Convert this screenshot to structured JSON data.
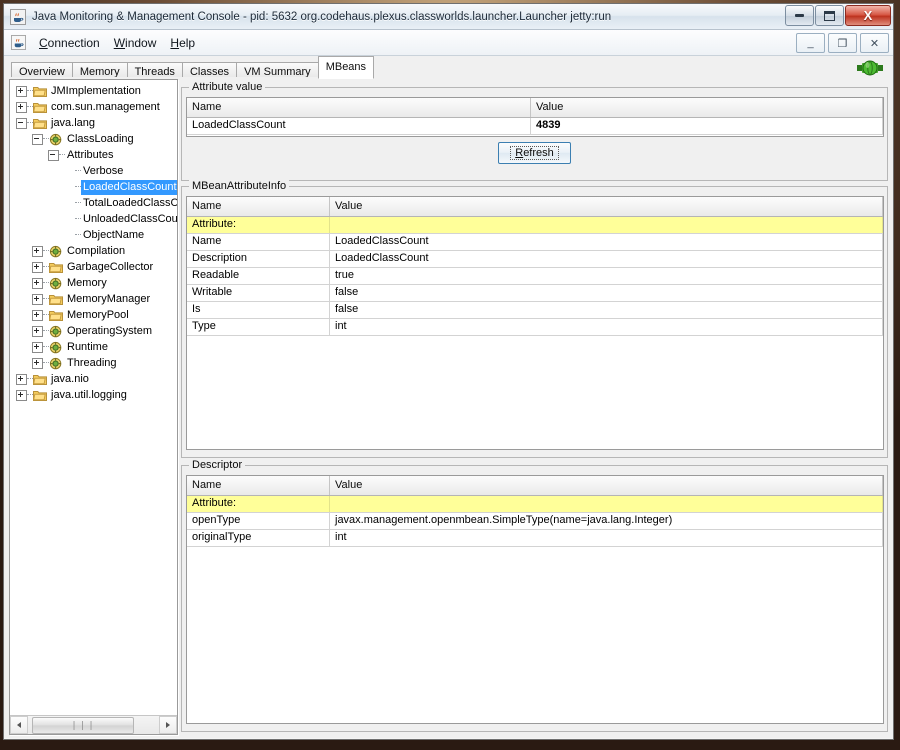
{
  "window": {
    "title": "Java Monitoring & Management Console - pid: 5632 org.codehaus.plexus.classworlds.launcher.Launcher jetty:run",
    "app_icon": "java-cup-icon",
    "buttons": {
      "minimize": "minimize-icon",
      "restore": "restore-icon",
      "close": "X"
    }
  },
  "menubar": {
    "icon": "java-cup-icon",
    "items": [
      {
        "label": "Connection",
        "mnemonic": "C"
      },
      {
        "label": "Window",
        "mnemonic": "W"
      },
      {
        "label": "Help",
        "mnemonic": "H"
      }
    ],
    "internal_buttons": {
      "minimize": "_",
      "maximize": "❐",
      "close": "✕"
    }
  },
  "tabs": {
    "items": [
      {
        "label": "Overview",
        "active": false
      },
      {
        "label": "Memory",
        "active": false
      },
      {
        "label": "Threads",
        "active": false
      },
      {
        "label": "Classes",
        "active": false
      },
      {
        "label": "VM Summary",
        "active": false
      },
      {
        "label": "MBeans",
        "active": true
      }
    ],
    "status_icon": "connection-plug-icon"
  },
  "tree": {
    "nodes": [
      {
        "label": "JMImplementation",
        "depth": 0,
        "toggle": "plus",
        "icon": "folder-icon",
        "selected": false
      },
      {
        "label": "com.sun.management",
        "depth": 0,
        "toggle": "plus",
        "icon": "folder-icon",
        "selected": false
      },
      {
        "label": "java.lang",
        "depth": 0,
        "toggle": "minus",
        "icon": "folder-icon",
        "selected": false
      },
      {
        "label": "ClassLoading",
        "depth": 1,
        "toggle": "minus",
        "icon": "mbean-icon",
        "selected": false
      },
      {
        "label": "Attributes",
        "depth": 2,
        "toggle": "minus",
        "icon": "none",
        "selected": false
      },
      {
        "label": "Verbose",
        "depth": 3,
        "toggle": "none",
        "icon": "none",
        "selected": false
      },
      {
        "label": "LoadedClassCount",
        "depth": 3,
        "toggle": "none",
        "icon": "none",
        "selected": true
      },
      {
        "label": "TotalLoadedClassCount",
        "depth": 3,
        "toggle": "none",
        "icon": "none",
        "selected": false
      },
      {
        "label": "UnloadedClassCount",
        "depth": 3,
        "toggle": "none",
        "icon": "none",
        "selected": false
      },
      {
        "label": "ObjectName",
        "depth": 3,
        "toggle": "none",
        "icon": "none",
        "selected": false
      },
      {
        "label": "Compilation",
        "depth": 1,
        "toggle": "plus",
        "icon": "mbean-icon",
        "selected": false
      },
      {
        "label": "GarbageCollector",
        "depth": 1,
        "toggle": "plus",
        "icon": "folder-icon",
        "selected": false
      },
      {
        "label": "Memory",
        "depth": 1,
        "toggle": "plus",
        "icon": "mbean-icon",
        "selected": false
      },
      {
        "label": "MemoryManager",
        "depth": 1,
        "toggle": "plus",
        "icon": "folder-icon",
        "selected": false
      },
      {
        "label": "MemoryPool",
        "depth": 1,
        "toggle": "plus",
        "icon": "folder-icon",
        "selected": false
      },
      {
        "label": "OperatingSystem",
        "depth": 1,
        "toggle": "plus",
        "icon": "mbean-icon",
        "selected": false
      },
      {
        "label": "Runtime",
        "depth": 1,
        "toggle": "plus",
        "icon": "mbean-icon",
        "selected": false
      },
      {
        "label": "Threading",
        "depth": 1,
        "toggle": "plus",
        "icon": "mbean-icon",
        "selected": false
      },
      {
        "label": "java.nio",
        "depth": 0,
        "toggle": "plus",
        "icon": "folder-icon",
        "selected": false
      },
      {
        "label": "java.util.logging",
        "depth": 0,
        "toggle": "plus",
        "icon": "folder-icon",
        "selected": false
      }
    ]
  },
  "attribute_value": {
    "group_title": "Attribute value",
    "columns": [
      "Name",
      "Value"
    ],
    "rows": [
      {
        "name": "LoadedClassCount",
        "value": "4839",
        "bold_value": true
      }
    ],
    "refresh_label": "Refresh",
    "refresh_mnemonic": "R"
  },
  "mbean_attribute_info": {
    "group_title": "MBeanAttributeInfo",
    "columns": [
      "Name",
      "Value"
    ],
    "rows": [
      {
        "name": "Attribute:",
        "value": "",
        "highlight": true
      },
      {
        "name": "Name",
        "value": "LoadedClassCount",
        "highlight": false
      },
      {
        "name": "Description",
        "value": "LoadedClassCount",
        "highlight": false
      },
      {
        "name": "Readable",
        "value": "true",
        "highlight": false
      },
      {
        "name": "Writable",
        "value": "false",
        "highlight": false
      },
      {
        "name": "Is",
        "value": "false",
        "highlight": false
      },
      {
        "name": "Type",
        "value": "int",
        "highlight": false
      }
    ]
  },
  "descriptor": {
    "group_title": "Descriptor",
    "columns": [
      "Name",
      "Value"
    ],
    "rows": [
      {
        "name": "Attribute:",
        "value": "",
        "highlight": true
      },
      {
        "name": "openType",
        "value": "javax.management.openmbean.SimpleType(name=java.lang.Integer)",
        "highlight": false
      },
      {
        "name": "originalType",
        "value": "int",
        "highlight": false
      }
    ]
  },
  "scrollbar": {
    "left_arrow": "◀",
    "right_arrow": "▶",
    "grip": "❘❘❘"
  },
  "colors": {
    "selection": "#3399ff",
    "highlight_row": "#ffff99",
    "accent": "#3c7fb1",
    "folder": "#ffcc66",
    "plug": "#3fae2a"
  }
}
